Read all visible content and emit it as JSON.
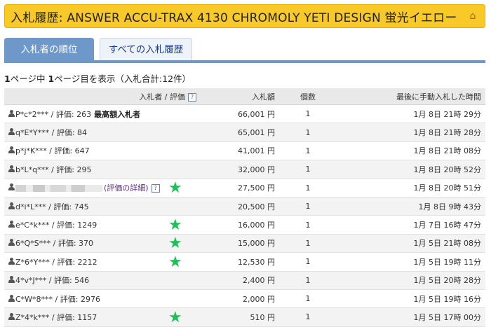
{
  "title": "入札履歴: ANSWER ACCU-TRAX 4130 CHROMOLY YETI DESIGN 蛍光イエロー",
  "title_icon": "label-icon",
  "tabs": [
    {
      "label": "入札者の順位"
    },
    {
      "label": "すべての入札履歴"
    }
  ],
  "summary": {
    "page_a": "1",
    "text_a": "ページ中",
    "page_b": "1",
    "text_b": "ページ目を表示（入札合計:12件）"
  },
  "table": {
    "headers": {
      "bidder": "入札者 / 評価",
      "amount": "入札額",
      "qty": "個数",
      "time": "最後に手動入札した時間"
    },
    "rows": [
      {
        "bidder": "P*c*2*** / 評価: 263",
        "label": "最高額入札者",
        "amount": "66,001 円",
        "qty": "1",
        "time": "1月 8日 21時 29分"
      },
      {
        "bidder": "q*E*Y*** / 評価: 84",
        "amount": "65,001 円",
        "qty": "1",
        "time": "1月 8日 21時 28分"
      },
      {
        "bidder": "p*j*K*** / 評価: 647",
        "amount": "41,001 円",
        "qty": "1",
        "time": "1月 8日 21時 08分"
      },
      {
        "bidder": "b*L*q*** / 評価: 295",
        "amount": "32,000 円",
        "qty": "1",
        "time": "1月 8日 20時 52分"
      },
      {
        "bidder": "",
        "detail": "(評価の詳細)",
        "amount": "27,500 円",
        "qty": "1",
        "time": "1月 8日 20時 51分"
      },
      {
        "bidder": "d*i*L*** / 評価: 745",
        "amount": "20,500 円",
        "qty": "1",
        "time": "1月 8日 9時 43分"
      },
      {
        "bidder": "e*C*k*** / 評価: 1249",
        "amount": "16,000 円",
        "qty": "1",
        "time": "1月 7日 16時 47分"
      },
      {
        "bidder": "6*Q*S*** / 評価: 370",
        "amount": "15,000 円",
        "qty": "1",
        "time": "1月 5日 21時 08分"
      },
      {
        "bidder": "Z*6*Y*** / 評価: 2212",
        "amount": "12,530 円",
        "qty": "1",
        "time": "1月 5日 19時 11分"
      },
      {
        "bidder": "4*v*J*** / 評価: 546",
        "amount": "2,400 円",
        "qty": "1",
        "time": "1月 5日 20時 28分"
      },
      {
        "bidder": "C*W*8*** / 評価: 2976",
        "amount": "2,000 円",
        "qty": "1",
        "time": "1月 5日 19時 16分"
      },
      {
        "bidder": "Z*4*k*** / 評価: 1157",
        "amount": "510 円",
        "qty": "1",
        "time": "1月 5日 17時 00分"
      }
    ]
  },
  "colors": {
    "title_bg": "#f9c92a",
    "tab_active": "#6d98c9",
    "star": "#1fbf5a"
  }
}
